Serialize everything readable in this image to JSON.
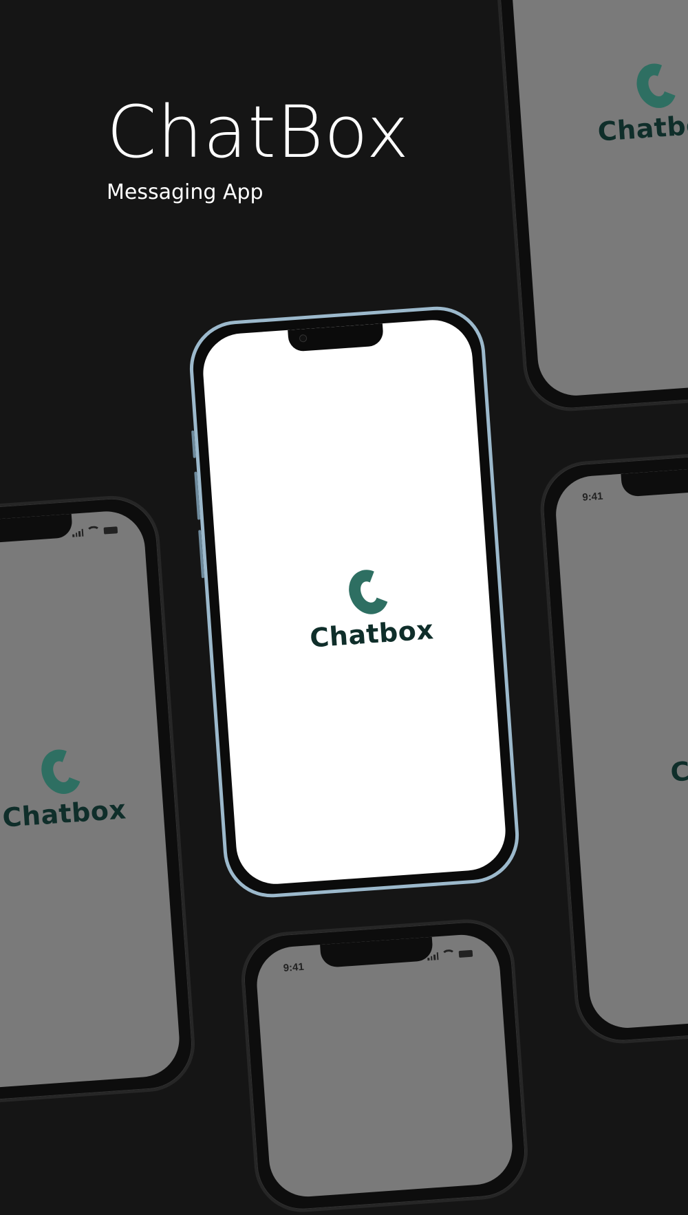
{
  "header": {
    "title": "ChatBox",
    "subtitle": "Messaging App"
  },
  "brand": {
    "logo_icon": "chatbox-c-logo-icon",
    "wordmark": "Chatbox",
    "accent_color": "#2e6f62",
    "wordmark_color": "#0f2e2a"
  },
  "phones": {
    "bottom_left": {
      "wordmark": "Chatbox"
    },
    "top_right": {
      "wordmark": "Chatbox"
    },
    "right": {
      "time": "9:41",
      "wordmark": "Ch"
    },
    "bottom_center": {
      "time": "9:41"
    }
  }
}
